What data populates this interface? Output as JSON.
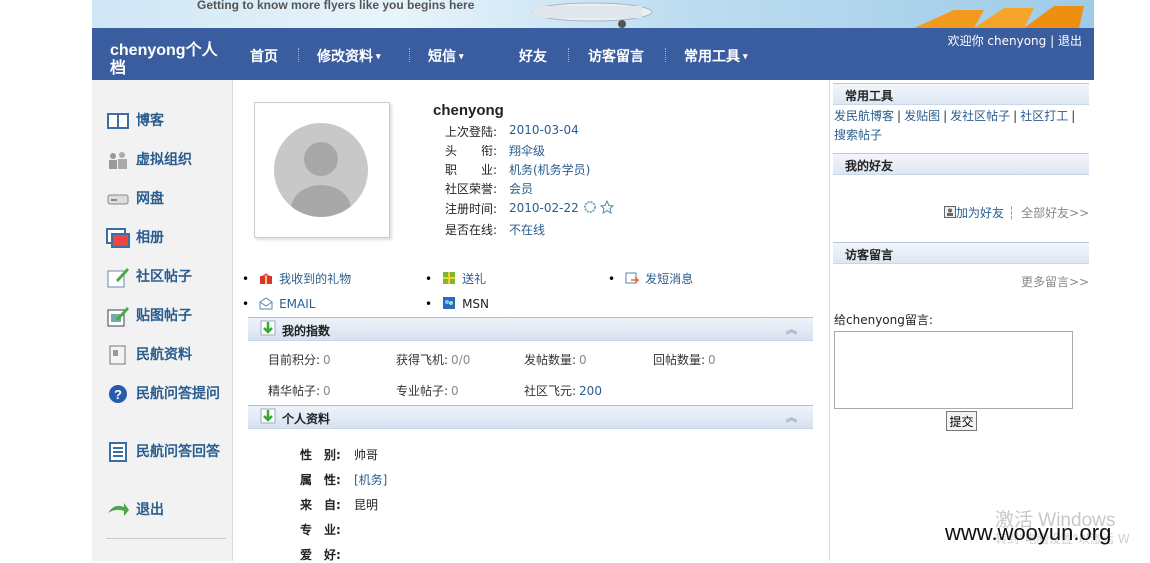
{
  "banner": {
    "tagline": "Getting to know more flyers like you begins here"
  },
  "nav": {
    "brand": "chenyong个人档",
    "items": [
      {
        "label": "首页",
        "caret": false
      },
      {
        "label": "修改资料",
        "caret": true
      },
      {
        "label": "短信",
        "caret": true
      },
      {
        "label": "好友",
        "caret": false
      },
      {
        "label": "访客留言",
        "caret": false
      },
      {
        "label": "常用工具",
        "caret": true
      }
    ],
    "caret_glyph": "▾",
    "welcome": "欢迎你 chenyong",
    "divider": "|",
    "logout": "退出"
  },
  "sidebar": {
    "items": [
      {
        "label": "博客",
        "icon": "book-icon"
      },
      {
        "label": "虚拟组织",
        "icon": "group-icon"
      },
      {
        "label": "网盘",
        "icon": "drive-icon"
      },
      {
        "label": "相册",
        "icon": "album-icon"
      },
      {
        "label": "社区帖子",
        "icon": "pencil-post-icon"
      },
      {
        "label": "贴图帖子",
        "icon": "image-post-icon"
      },
      {
        "label": "民航资料",
        "icon": "document-icon"
      },
      {
        "label": "民航问答提问",
        "icon": "question-icon"
      },
      {
        "label": "民航问答回答",
        "icon": "answer-icon"
      },
      {
        "label": "退出",
        "icon": "exit-arrow-icon"
      }
    ]
  },
  "profile": {
    "username": "chenyong",
    "fields": [
      {
        "label": "上次登陆:",
        "value": "2010-03-04"
      },
      {
        "label": "头　　衔:",
        "value": "翔伞级"
      },
      {
        "label": "职　　业:",
        "value": "机务(机务学员)"
      },
      {
        "label": "社区荣誉:",
        "value": "会员"
      },
      {
        "label": "注册时间:",
        "value": "2010-02-22"
      },
      {
        "label": "是否在线:",
        "value": "不在线"
      }
    ],
    "links": [
      {
        "label": "我收到的礼物",
        "icon": "gift-icon"
      },
      {
        "label": "送礼",
        "icon": "present-icon"
      },
      {
        "label": "发短消息",
        "icon": "message-icon"
      },
      {
        "label": "EMAIL",
        "icon": "email-icon"
      },
      {
        "label": "MSN",
        "icon": "msn-icon"
      }
    ],
    "bullet": "•"
  },
  "index_section": {
    "title": "我的指数",
    "collapse_glyph": "︽",
    "stats": [
      {
        "label": "目前积分:",
        "value": "0"
      },
      {
        "label": "获得飞机:",
        "value": "0/0"
      },
      {
        "label": "发帖数量:",
        "value": "0"
      },
      {
        "label": "回帖数量:",
        "value": "0"
      },
      {
        "label": "精华帖子:",
        "value": "0"
      },
      {
        "label": "专业帖子:",
        "value": "0"
      },
      {
        "label": "社区飞元:",
        "value": "200"
      }
    ]
  },
  "personal_section": {
    "title": "个人资料",
    "collapse_glyph": "︽",
    "rows": [
      {
        "label": "性　别:",
        "value": "帅哥"
      },
      {
        "label": "属　性:",
        "value": "[机务]"
      },
      {
        "label": "来　自:",
        "value": "昆明"
      },
      {
        "label": "专　业:",
        "value": ""
      },
      {
        "label": "爱　好:",
        "value": ""
      }
    ]
  },
  "tools": {
    "title": "常用工具",
    "links": [
      "发民航博客",
      "发贴图",
      "发社区帖子",
      "社区打工",
      "搜索帖子"
    ],
    "separator": "|"
  },
  "friends": {
    "title": "我的好友",
    "add_label": "加为好友",
    "all_label": "全部好友>>",
    "divider": "┆"
  },
  "guestbook": {
    "title": "访客留言",
    "more_label": "更多留言>>",
    "prompt": "给chenyong留言:",
    "submit_label": "提交"
  },
  "watermark": {
    "activate": "激活 Windows",
    "activate_sub": "转到\"电脑设置\"以激活 W",
    "site": "www.wooyun.org"
  },
  "colors": {
    "nav_bg": "#3a5da0",
    "link": "#2a5d8f"
  }
}
